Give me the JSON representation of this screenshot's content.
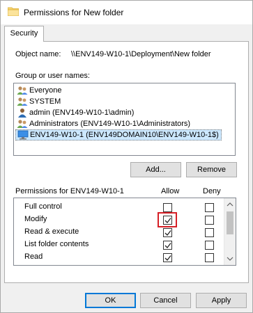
{
  "window": {
    "title": "Permissions for New folder"
  },
  "tabs": [
    {
      "label": "Security"
    }
  ],
  "object": {
    "label": "Object name:",
    "value": "\\\\ENV149-W10-1\\Deployment\\New folder"
  },
  "groups": {
    "label": "Group or user names:",
    "items": [
      {
        "name": "Everyone",
        "icon": "group-icon"
      },
      {
        "name": "SYSTEM",
        "icon": "group-icon"
      },
      {
        "name": "admin (ENV149-W10-1\\admin)",
        "icon": "user-icon"
      },
      {
        "name": "Administrators (ENV149-W10-1\\Administrators)",
        "icon": "group-icon"
      },
      {
        "name": "ENV149-W10-1 (ENV149DOMAIN10\\ENV149-W10-1$)",
        "icon": "computer-icon",
        "selected": true
      }
    ],
    "add_label": "Add...",
    "remove_label": "Remove"
  },
  "permissions": {
    "label": "Permissions for ENV149-W10-1",
    "allow_header": "Allow",
    "deny_header": "Deny",
    "rows": [
      {
        "name": "Full control",
        "allow": false,
        "deny": false
      },
      {
        "name": "Modify",
        "allow": true,
        "deny": false,
        "highlighted": true
      },
      {
        "name": "Read & execute",
        "allow": true,
        "deny": false
      },
      {
        "name": "List folder contents",
        "allow": true,
        "deny": false
      },
      {
        "name": "Read",
        "allow": true,
        "deny": false
      }
    ]
  },
  "footer": {
    "ok_label": "OK",
    "cancel_label": "Cancel",
    "apply_label": "Apply"
  },
  "colors": {
    "selection": "#cce8ff",
    "highlight_border": "#d61f26",
    "default_button_border": "#0078d7"
  }
}
